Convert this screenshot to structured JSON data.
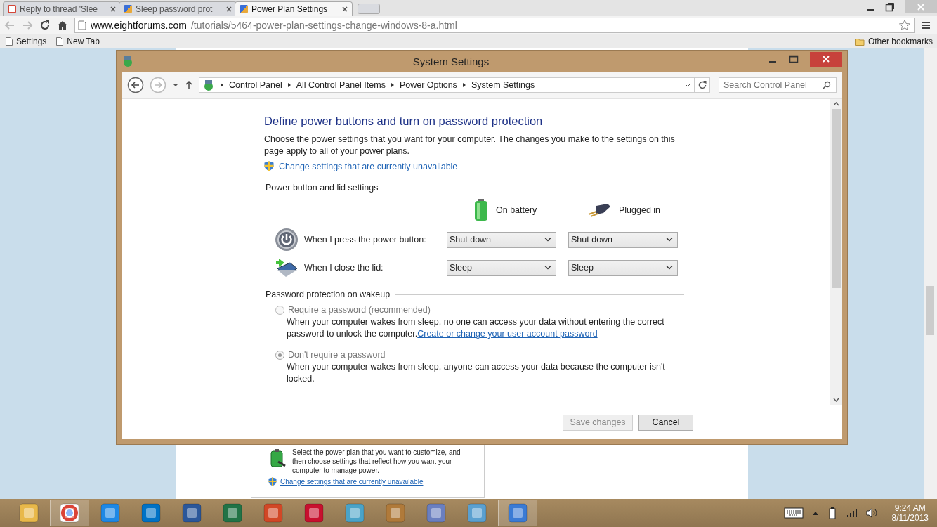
{
  "browser": {
    "tabs": [
      {
        "title": "Reply to thread 'Slee",
        "selected": false
      },
      {
        "title": "Sleep password prot",
        "selected": false
      },
      {
        "title": "Power Plan Settings",
        "selected": true
      }
    ],
    "address": {
      "domain": "www.eightforums.com",
      "path": "/tutorials/5464-power-plan-settings-change-windows-8-a.html"
    },
    "bookmarks": [
      "Settings",
      "New Tab"
    ],
    "other_bookmarks": "Other bookmarks"
  },
  "page_behind": {
    "description": "Select the power plan that you want to customize, and then choose settings that reflect how you want your computer to manage power.",
    "link": "Change settings that are currently unavailable"
  },
  "dialog": {
    "title": "System Settings",
    "breadcrumb": [
      "Control Panel",
      "All Control Panel Items",
      "Power Options",
      "System Settings"
    ],
    "search": {
      "placeholder": "Search Control Panel"
    },
    "heading": "Define power buttons and turn on password protection",
    "intro": "Choose the power settings that you want for your computer. The changes you make to the settings on this page apply to all of your power plans.",
    "admin_link": "Change settings that are currently unavailable",
    "power_section": {
      "title": "Power button and lid settings",
      "columns": [
        "On battery",
        "Plugged in"
      ],
      "rows": [
        {
          "kind": "power",
          "label": "When I press the power button:",
          "values": [
            "Shut down",
            "Shut down"
          ]
        },
        {
          "kind": "lid",
          "label": "When I close the lid:",
          "values": [
            "Sleep",
            "Sleep"
          ]
        }
      ]
    },
    "password_section": {
      "title": "Password protection on wakeup",
      "options": [
        {
          "label": "Require a password (recommended)",
          "selected": false,
          "disabled": true,
          "description": "When your computer wakes from sleep, no one can access your data without entering the correct password to unlock the computer.",
          "link": "Create or change your user account password"
        },
        {
          "label": "Don't require a password",
          "selected": true,
          "disabled": true,
          "description": "When your computer wakes from sleep, anyone can access your data because the computer isn't locked."
        }
      ]
    },
    "buttons": [
      {
        "label": "Save changes",
        "disabled": true
      },
      {
        "label": "Cancel",
        "disabled": false
      }
    ]
  },
  "taskbar": {
    "apps": [
      {
        "selected": false
      },
      {
        "selected": true
      },
      {
        "selected": false
      },
      {
        "selected": false
      },
      {
        "selected": false
      },
      {
        "selected": false
      },
      {
        "selected": false
      },
      {
        "selected": false
      },
      {
        "selected": false
      },
      {
        "selected": false
      },
      {
        "selected": false
      },
      {
        "selected": false
      },
      {
        "selected": true
      }
    ],
    "time": "9:24 AM",
    "date": "8/11/2013"
  }
}
